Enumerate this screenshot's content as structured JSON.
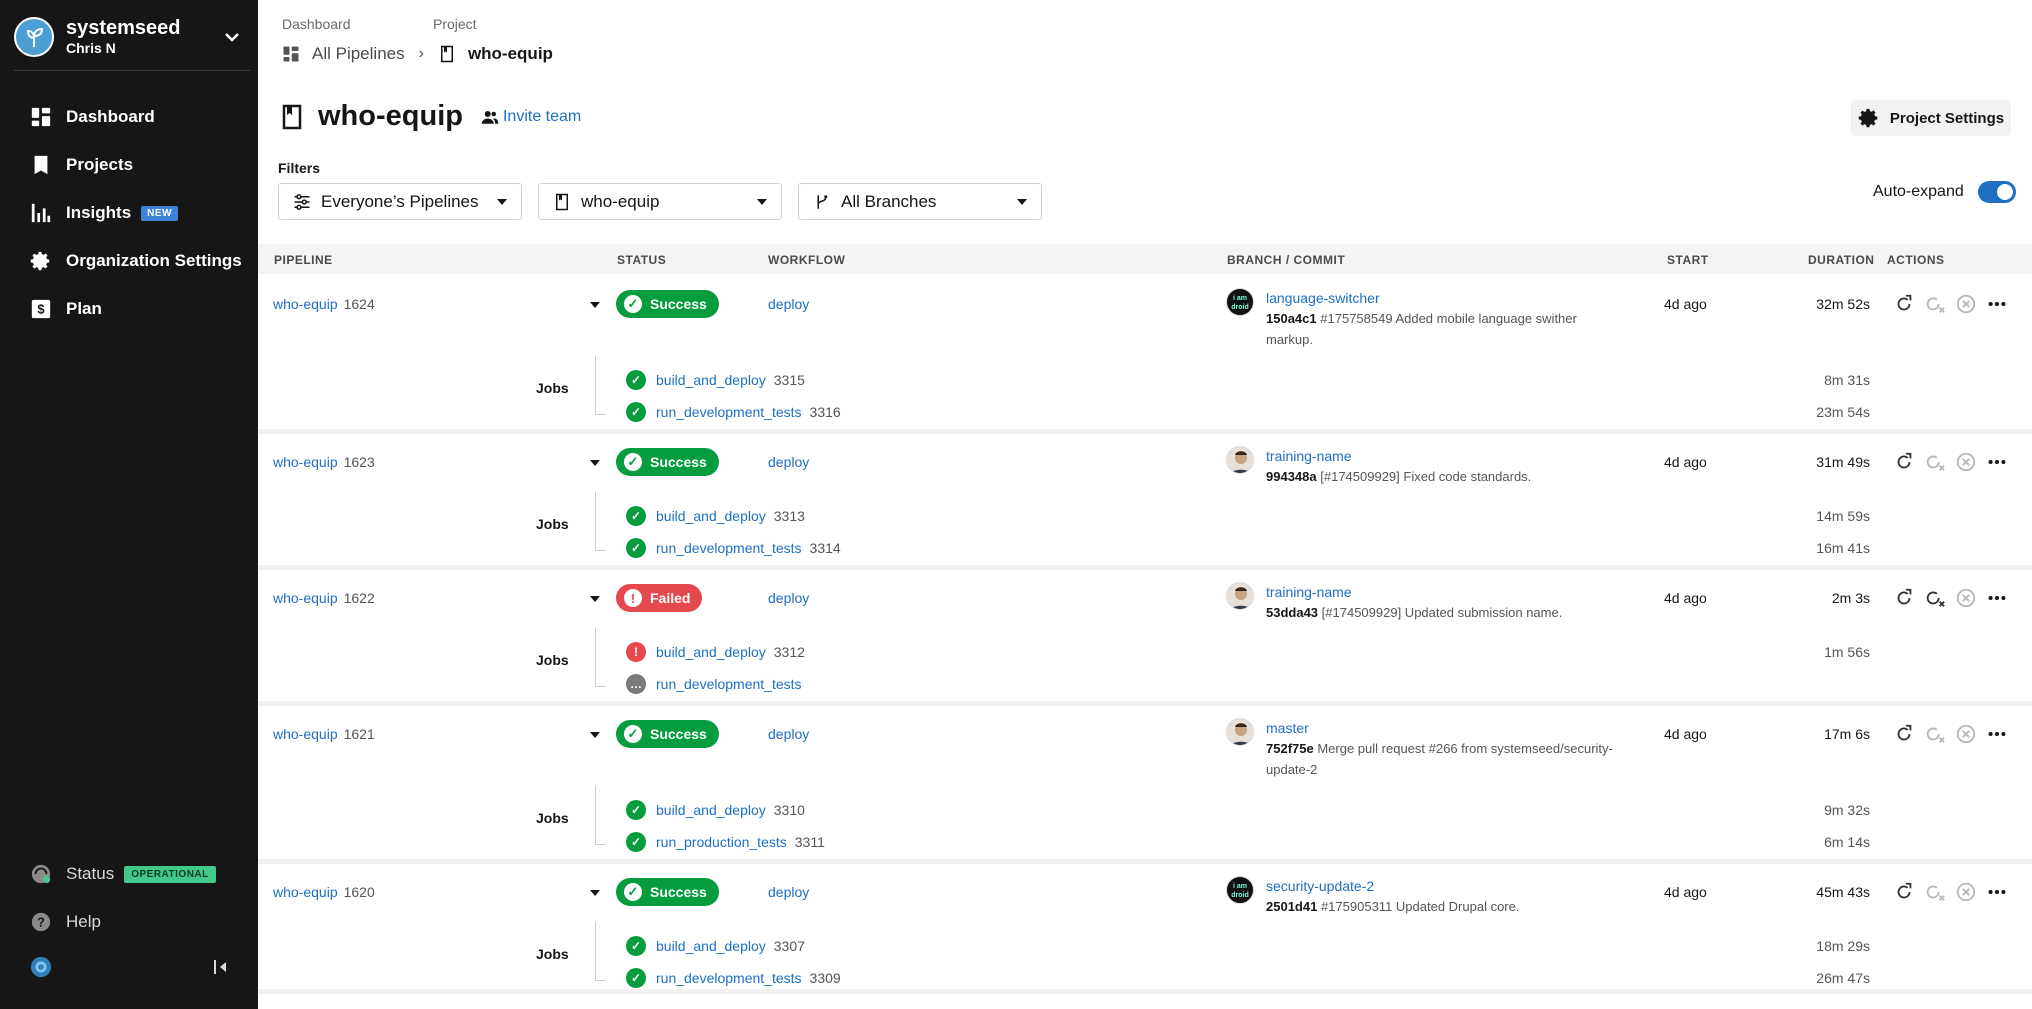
{
  "sidebar": {
    "org_name": "systemseed",
    "user_name": "Chris N",
    "nav": [
      {
        "label": "Dashboard",
        "icon": "dashboard-icon"
      },
      {
        "label": "Projects",
        "icon": "projects-icon"
      },
      {
        "label": "Insights",
        "icon": "insights-icon",
        "badge": "NEW"
      },
      {
        "label": "Organization Settings",
        "icon": "gear-icon"
      },
      {
        "label": "Plan",
        "icon": "dollar-icon"
      }
    ],
    "status_label": "Status",
    "status_badge": "OPERATIONAL",
    "help_label": "Help"
  },
  "breadcrumb": {
    "label_dashboard": "Dashboard",
    "label_project": "Project",
    "all_pipelines": "All Pipelines",
    "current": "who-equip"
  },
  "project": {
    "title": "who-equip",
    "invite": "Invite team",
    "settings": "Project Settings"
  },
  "filters": {
    "label": "Filters",
    "pipelines": "Everyone’s Pipelines",
    "project": "who-equip",
    "branches": "All Branches",
    "auto_expand": "Auto-expand"
  },
  "table": {
    "headers": {
      "pipeline": "PIPELINE",
      "status": "STATUS",
      "workflow": "WORKFLOW",
      "branch": "BRANCH / COMMIT",
      "start": "START",
      "duration": "DURATION",
      "actions": "ACTIONS"
    },
    "jobs_label": "Jobs",
    "pipelines": [
      {
        "project": "who-equip",
        "number": "1624",
        "status": "Success",
        "workflow": "deploy",
        "branch": "language-switcher",
        "sha": "150a4c1",
        "message": "#175758549 Added mobile language swither markup.",
        "start": "4d ago",
        "duration": "32m 52s",
        "jobs": [
          {
            "name": "build_and_deploy",
            "number": "3315",
            "duration": "8m 31s"
          },
          {
            "name": "run_development_tests",
            "number": "3316",
            "duration": "23m 54s"
          }
        ]
      },
      {
        "project": "who-equip",
        "number": "1623",
        "status": "Success",
        "workflow": "deploy",
        "branch": "training-name",
        "sha": "994348a",
        "message": "[#174509929] Fixed code standards.",
        "start": "4d ago",
        "duration": "31m 49s",
        "jobs": [
          {
            "name": "build_and_deploy",
            "number": "3313",
            "duration": "14m 59s"
          },
          {
            "name": "run_development_tests",
            "number": "3314",
            "duration": "16m 41s"
          }
        ]
      },
      {
        "project": "who-equip",
        "number": "1622",
        "status": "Failed",
        "workflow": "deploy",
        "branch": "training-name",
        "sha": "53dda43",
        "message": "[#174509929] Updated submission name.",
        "start": "4d ago",
        "duration": "2m 3s",
        "jobs": [
          {
            "name": "build_and_deploy",
            "number": "3312",
            "duration": "1m 56s"
          },
          {
            "name": "run_development_tests",
            "number": "",
            "duration": ""
          }
        ]
      },
      {
        "project": "who-equip",
        "number": "1621",
        "status": "Success",
        "workflow": "deploy",
        "branch": "master",
        "sha": "752f75e",
        "message": "Merge pull request #266 from systemseed/security-update-2",
        "start": "4d ago",
        "duration": "17m 6s",
        "jobs": [
          {
            "name": "build_and_deploy",
            "number": "3310",
            "duration": "9m 32s"
          },
          {
            "name": "run_production_tests",
            "number": "3311",
            "duration": "6m 14s"
          }
        ]
      },
      {
        "project": "who-equip",
        "number": "1620",
        "status": "Success",
        "workflow": "deploy",
        "branch": "security-update-2",
        "sha": "2501d41",
        "message": "#175905311 Updated Drupal core.",
        "start": "4d ago",
        "duration": "45m 43s",
        "jobs": [
          {
            "name": "build_and_deploy",
            "number": "3307",
            "duration": "18m 29s"
          },
          {
            "name": "run_development_tests",
            "number": "3309",
            "duration": "26m 47s"
          }
        ]
      }
    ]
  },
  "colors": {
    "sidebar_bg": "#161616",
    "link": "#1e6fc2",
    "success": "#079d3f",
    "failed": "#e5484d",
    "badge_new": "#3e84d6",
    "badge_operational": "#42c88a"
  }
}
